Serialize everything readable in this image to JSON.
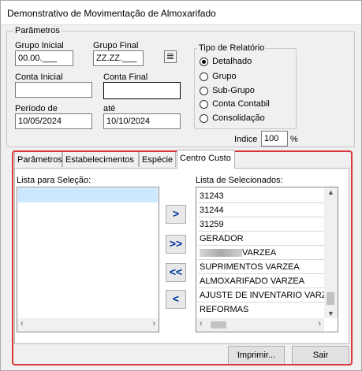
{
  "window": {
    "title": "Demonstrativo de Movimentação de Almoxarifado"
  },
  "params_group": {
    "legend": "Parâmetros",
    "grupo_inicial": {
      "label": "Grupo Inicial",
      "value": "00.00.___"
    },
    "grupo_final": {
      "label": "Grupo Final",
      "value": "ZZ.ZZ.___"
    },
    "conta_inicial": {
      "label": "Conta Inicial",
      "value": ""
    },
    "conta_final": {
      "label": "Conta Final",
      "value": ""
    },
    "periodo_de": {
      "label": "Período de",
      "value": "10/05/2024"
    },
    "ate": {
      "label": "até",
      "value": "10/10/2024"
    },
    "lookup_icon": "list-lookup-icon"
  },
  "report_type": {
    "legend": "Tipo de Relatório",
    "options": [
      "Detalhado",
      "Grupo",
      "Sub-Grupo",
      "Conta Contabil",
      "Consolidação"
    ],
    "selected": "Detalhado"
  },
  "indice": {
    "label": "Indice",
    "value": "100",
    "unit": "%"
  },
  "tabs": [
    "Parâmetros",
    "Estabelecimentos",
    "Espécie",
    "Centro Custo"
  ],
  "active_tab": "Centro Custo",
  "centro_custo": {
    "available_label": "Lista para Seleção:",
    "selected_label": "Lista de Selecionados:",
    "available_items": [
      ""
    ],
    "selected_items": [
      "31243",
      "31244",
      "31259",
      "GERADOR",
      "VARZEA",
      "SUPRIMENTOS VARZEA",
      "ALMOXARIFADO VARZEA",
      "AJUSTE DE INVENTARIO VARZEA",
      "REFORMAS"
    ],
    "move_buttons": [
      ">",
      ">>",
      "<<",
      "<"
    ]
  },
  "footer": {
    "print_label": "Imprimir...",
    "exit_label": "Sair"
  },
  "colors": {
    "highlight": "#d9363e",
    "selection": "#cce8ff",
    "arrow": "#0033a0"
  }
}
